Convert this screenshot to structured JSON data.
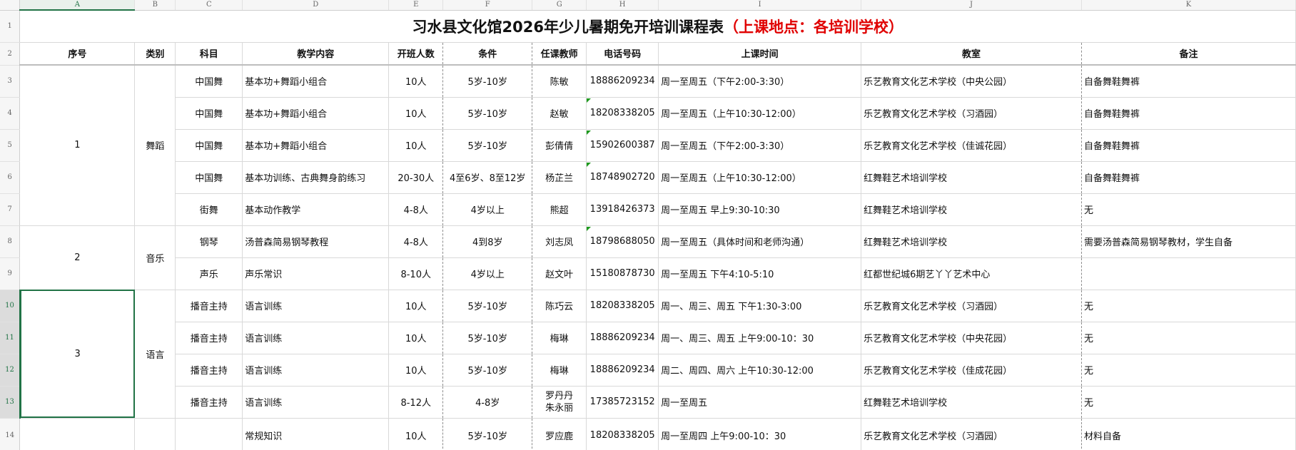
{
  "colors": {
    "accent": "#217346",
    "title_highlight": "#e00000"
  },
  "columns": [
    "A",
    "B",
    "C",
    "D",
    "E",
    "F",
    "G",
    "H",
    "I",
    "J",
    "K"
  ],
  "active_column": "A",
  "active_rows": [
    "10",
    "11",
    "12",
    "13"
  ],
  "row_numbers": [
    "1",
    "2",
    "3",
    "4",
    "5",
    "6",
    "7",
    "8",
    "9",
    "10",
    "11",
    "12",
    "13",
    "14"
  ],
  "title": {
    "main": "习水县文化馆2026年少儿暑期免开培训课程表",
    "highlight": "（上课地点：各培训学校）"
  },
  "headers": [
    "序号",
    "类别",
    "科目",
    "教学内容",
    "开班人数",
    "条件",
    "任课教师",
    "电话号码",
    "上课时间",
    "教室",
    "备注"
  ],
  "groups": [
    {
      "index": "1",
      "category": "舞蹈"
    },
    {
      "index": "2",
      "category": "音乐"
    },
    {
      "index": "3",
      "category": "语言"
    }
  ],
  "rows": [
    {
      "subject": "中国舞",
      "content": "基本功+舞蹈小组合",
      "size": "10人",
      "condition": "5岁-10岁",
      "teacher": "陈敏",
      "phone": "18886209234",
      "time": "周一至周五（下午2:00-3:30）",
      "room": "乐艺教育文化艺术学校（中央公园）",
      "note": "自备舞鞋舞裤"
    },
    {
      "subject": "中国舞",
      "content": "基本功+舞蹈小组合",
      "size": "10人",
      "condition": "5岁-10岁",
      "teacher": "赵敏",
      "phone": "18208338205",
      "time": "周一至周五（上午10:30-12:00）",
      "room": "乐艺教育文化艺术学校（习酒园）",
      "note": "自备舞鞋舞裤"
    },
    {
      "subject": "中国舞",
      "content": "基本功+舞蹈小组合",
      "size": "10人",
      "condition": "5岁-10岁",
      "teacher": "彭倩倩",
      "phone": "15902600387",
      "time": "周一至周五（下午2:00-3:30）",
      "room": "乐艺教育文化艺术学校（佳诚花园）",
      "note": "自备舞鞋舞裤"
    },
    {
      "subject": "中国舞",
      "content": "基本功训练、古典舞身韵练习",
      "size": "20-30人",
      "condition": "4至6岁、8至12岁",
      "teacher": "杨芷兰",
      "phone": "18748902720",
      "time": "周一至周五（上午10:30-12:00）",
      "room": "红舞鞋艺术培训学校",
      "note": "自备舞鞋舞裤"
    },
    {
      "subject": "街舞",
      "content": "基本动作教学",
      "size": "4-8人",
      "condition": "4岁以上",
      "teacher": "熊超",
      "phone": "13918426373",
      "time": "周一至周五 早上9:30-10:30",
      "room": "红舞鞋艺术培训学校",
      "note": "无"
    },
    {
      "subject": "钢琴",
      "content": "汤普森简易钢琴教程",
      "size": "4-8人",
      "condition": "4到8岁",
      "teacher": "刘志凤",
      "phone": "18798688050",
      "time": "周一至周五（具体时间和老师沟通）",
      "room": "红舞鞋艺术培训学校",
      "note": "需要汤普森简易钢琴教材，学生自备"
    },
    {
      "subject": "声乐",
      "content": "声乐常识",
      "size": "8-10人",
      "condition": "4岁以上",
      "teacher": "赵文叶",
      "phone": "15180878730",
      "time": "周一至周五 下午4:10-5:10",
      "room": "红都世纪城6期艺丫丫艺术中心",
      "note": ""
    },
    {
      "subject": "播音主持",
      "content": "语言训练",
      "size": "10人",
      "condition": "5岁-10岁",
      "teacher": "陈巧云",
      "phone": "18208338205",
      "time": "周一、周三、周五 下午1:30-3:00",
      "room": "乐艺教育文化艺术学校（习酒园）",
      "note": "无"
    },
    {
      "subject": "播音主持",
      "content": "语言训练",
      "size": "10人",
      "condition": "5岁-10岁",
      "teacher": "梅琳",
      "phone": "18886209234",
      "time": "周一、周三、周五 上午9:00-10：30",
      "room": "乐艺教育文化艺术学校（中央花园）",
      "note": "无"
    },
    {
      "subject": "播音主持",
      "content": "语言训练",
      "size": "10人",
      "condition": "5岁-10岁",
      "teacher": "梅琳",
      "phone": "18886209234",
      "time": "周二、周四、周六 上午10:30-12:00",
      "room": "乐艺教育文化艺术学校（佳成花园）",
      "note": "无"
    },
    {
      "subject": "播音主持",
      "content": "语言训练",
      "size": "8-12人",
      "condition": "4-8岁",
      "teacher": "罗丹丹",
      "teacher2": "朱永丽",
      "phone": "17385723152",
      "time": "周一至周五",
      "room": "红舞鞋艺术培训学校",
      "note": "无"
    },
    {
      "subject": "",
      "content": "常规知识",
      "size": "10人",
      "condition": "5岁-10岁",
      "teacher": "罗应鹿",
      "phone": "18208338205",
      "time": "周一至周四 上午9:00-10：30",
      "room": "乐艺教育文化艺术学校（习酒园）",
      "note": "材料自备"
    }
  ]
}
